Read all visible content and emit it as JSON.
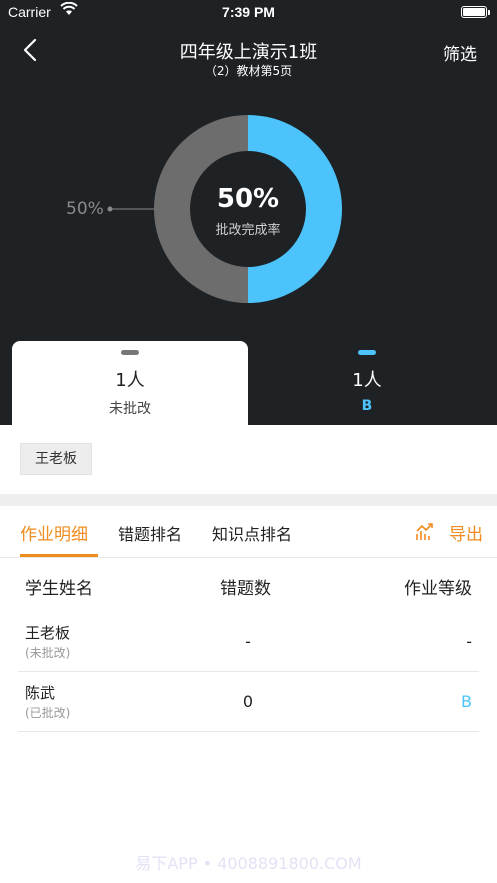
{
  "status_bar": {
    "carrier": "Carrier",
    "time": "7:39 PM"
  },
  "header": {
    "title": "四年级上演示1班",
    "subtitle": "（2）教材第5页",
    "filter_label": "筛选"
  },
  "donut": {
    "center_value": "50%",
    "center_label": "批改完成率",
    "side_value": "50%",
    "completed_fraction": 0.5,
    "completed_color": "#4cc4fb",
    "pending_color": "#6d6d6d"
  },
  "summary_tabs": [
    {
      "count": "1人",
      "label": "未批改",
      "pill_color": "#777777",
      "label_color": "#444444"
    },
    {
      "count": "1人",
      "label": "B",
      "pill_color": "#4cc4fb",
      "label_color": "#4cc4fb"
    }
  ],
  "student_chip": "王老板",
  "tabs": [
    {
      "label": "作业明细"
    },
    {
      "label": "错题排名"
    },
    {
      "label": "知识点排名"
    }
  ],
  "export_label": "导出",
  "accent_color": "#f08c1e",
  "table": {
    "headers": [
      "学生姓名",
      "错题数",
      "作业等级"
    ],
    "rows": [
      {
        "name": "王老板",
        "status": "(未批改)",
        "errors": "-",
        "grade": "-",
        "grade_color": "#222222"
      },
      {
        "name": "陈武",
        "status": "(已批改)",
        "errors": "0",
        "grade": "B",
        "grade_color": "#4cc4fb"
      }
    ]
  },
  "watermark": "易下APP • 4008891800.COM"
}
